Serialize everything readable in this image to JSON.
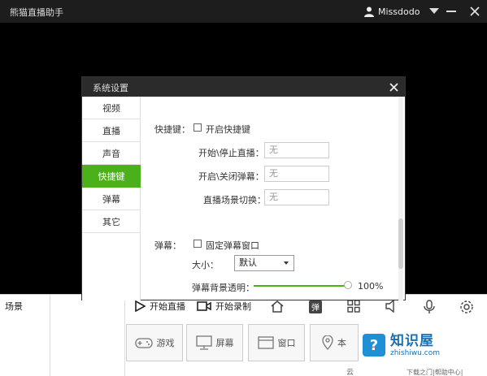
{
  "app": {
    "title": "熊猫直播助手",
    "username": "Missdodo"
  },
  "dialog": {
    "title": "系统设置",
    "nav": [
      {
        "label": "视频"
      },
      {
        "label": "直播"
      },
      {
        "label": "声音"
      },
      {
        "label": "快捷键",
        "active": true
      },
      {
        "label": "弹幕"
      },
      {
        "label": "其它"
      }
    ],
    "hotkeys": {
      "section_label": "快捷键：",
      "enable_label": "开启快捷键",
      "enabled": false,
      "fields": [
        {
          "label": "开始\\停止直播：",
          "value": "无"
        },
        {
          "label": "开启\\关闭弹幕：",
          "value": "无"
        },
        {
          "label": "直播场景切换：",
          "value": "无"
        }
      ]
    },
    "danmaku": {
      "section_label": "弹幕：",
      "fixed_label": "固定弹幕窗口",
      "fixed": false,
      "size_label": "大小：",
      "size_value": "默认",
      "opacity_label": "弹幕背景透明：",
      "opacity_value": "100%",
      "opacity_level": 1.0
    }
  },
  "bottom": {
    "scene_label": "场景",
    "start_live_label": "开始直播",
    "start_record_label": "开始录制",
    "sources": [
      {
        "label": "游戏",
        "icon": "gamepad-icon"
      },
      {
        "label": "屏幕",
        "icon": "monitor-icon"
      },
      {
        "label": "窗口",
        "icon": "window-icon"
      },
      {
        "label": "本",
        "icon": "location-icon"
      }
    ],
    "footer_text": "云",
    "footer_text2": "下载之门|帮助中心|",
    "colors": {
      "accent": "#4bb11a",
      "title_bg": "#1d1d1d"
    }
  },
  "watermark": {
    "title": "知识屋",
    "domain": "zhishiwu.com"
  }
}
